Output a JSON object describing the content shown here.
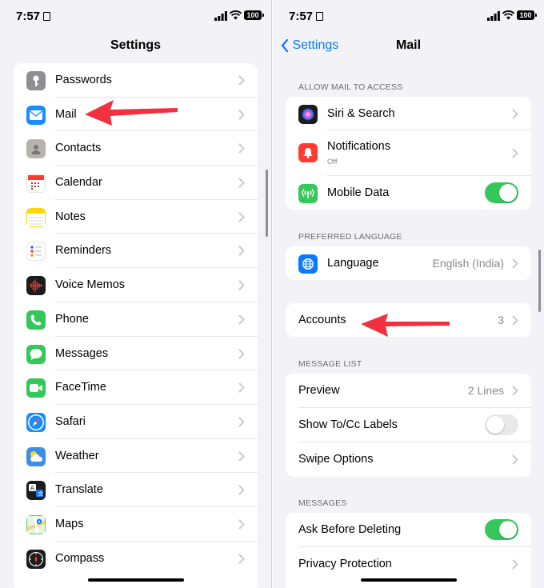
{
  "status": {
    "time": "7:57",
    "battery": "100"
  },
  "left": {
    "title": "Settings",
    "items": [
      {
        "label": "Passwords",
        "icon": "key-icon",
        "color": "#8e8e93"
      },
      {
        "label": "Mail",
        "icon": "mail-icon",
        "color": "#1a8cff"
      },
      {
        "label": "Contacts",
        "icon": "contacts-icon",
        "color": "#b8b4ad"
      },
      {
        "label": "Calendar",
        "icon": "calendar-icon",
        "color": "#ffffff"
      },
      {
        "label": "Notes",
        "icon": "notes-icon",
        "color": "#ffd60a"
      },
      {
        "label": "Reminders",
        "icon": "reminders-icon",
        "color": "#ffffff"
      },
      {
        "label": "Voice Memos",
        "icon": "waveform-icon",
        "color": "#1c1c1e"
      },
      {
        "label": "Phone",
        "icon": "phone-icon",
        "color": "#34c759"
      },
      {
        "label": "Messages",
        "icon": "messages-icon",
        "color": "#34c759"
      },
      {
        "label": "FaceTime",
        "icon": "facetime-icon",
        "color": "#34c759"
      },
      {
        "label": "Safari",
        "icon": "safari-icon",
        "color": "#1a8cff"
      },
      {
        "label": "Weather",
        "icon": "weather-icon",
        "color": "#3a8ee6"
      },
      {
        "label": "Translate",
        "icon": "translate-icon",
        "color": "#1c1c1e"
      },
      {
        "label": "Maps",
        "icon": "maps-icon",
        "color": "#6cc46c"
      },
      {
        "label": "Compass",
        "icon": "compass-icon",
        "color": "#1c1c1e"
      }
    ]
  },
  "right": {
    "back_label": "Settings",
    "title": "Mail",
    "sections": {
      "access_header": "ALLOW MAIL TO ACCESS",
      "siri": "Siri & Search",
      "notifications": "Notifications",
      "notifications_sub": "Off",
      "mobile_data": "Mobile Data",
      "language_header": "PREFERRED LANGUAGE",
      "language": "Language",
      "language_value": "English (India)",
      "accounts": "Accounts",
      "accounts_value": "3",
      "message_list_header": "MESSAGE LIST",
      "preview": "Preview",
      "preview_value": "2 Lines",
      "show_tocc": "Show To/Cc Labels",
      "swipe": "Swipe Options",
      "messages_header": "MESSAGES",
      "ask_delete": "Ask Before Deleting",
      "privacy": "Privacy Protection"
    }
  },
  "colors": {
    "accent": "#0a7aff",
    "toggle_on": "#34c759",
    "arrow": "#f2303f"
  }
}
